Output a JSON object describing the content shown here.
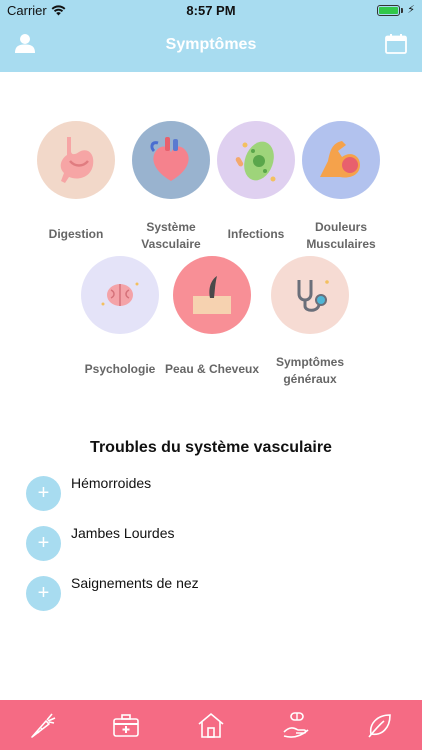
{
  "status_bar": {
    "carrier": "Carrier",
    "time": "8:57 PM"
  },
  "header": {
    "title": "Symptômes",
    "left_icon": "profile-icon",
    "right_icon": "calendar-icon"
  },
  "categories": [
    {
      "label": "Digestion",
      "icon": "stomach-icon",
      "color": "#f2d8c9"
    },
    {
      "label": "Système Vasculaire",
      "icon": "heart-icon",
      "color": "#99b3cf"
    },
    {
      "label": "Infections",
      "icon": "bacteria-icon",
      "color": "#dfd0f0"
    },
    {
      "label": "Douleurs Musculaires",
      "icon": "muscle-icon",
      "color": "#b2c2ee"
    },
    {
      "label": "Psychologie",
      "icon": "brain-icon",
      "color": "#e4e3f8"
    },
    {
      "label": "Peau & Cheveux",
      "icon": "skin-hair-icon",
      "color": "#f88f96"
    },
    {
      "label": "Symptômes généraux",
      "icon": "stethoscope-icon",
      "color": "#f6dbd3"
    }
  ],
  "section": {
    "title": "Troubles du système vasculaire",
    "items": [
      {
        "label": "Hémorroides"
      },
      {
        "label": "Jambes Lourdes"
      },
      {
        "label": "Saignements de nez"
      }
    ],
    "add_glyph": "+"
  },
  "tabbar": {
    "color": "#f56b84",
    "tabs": [
      "carrot-icon",
      "first-aid-kit-icon",
      "home-icon",
      "pill-hand-icon",
      "leaf-icon"
    ]
  },
  "colors": {
    "header": "#a8dcf0",
    "accent": "#a8dcf0",
    "tabbar": "#f56b84"
  }
}
